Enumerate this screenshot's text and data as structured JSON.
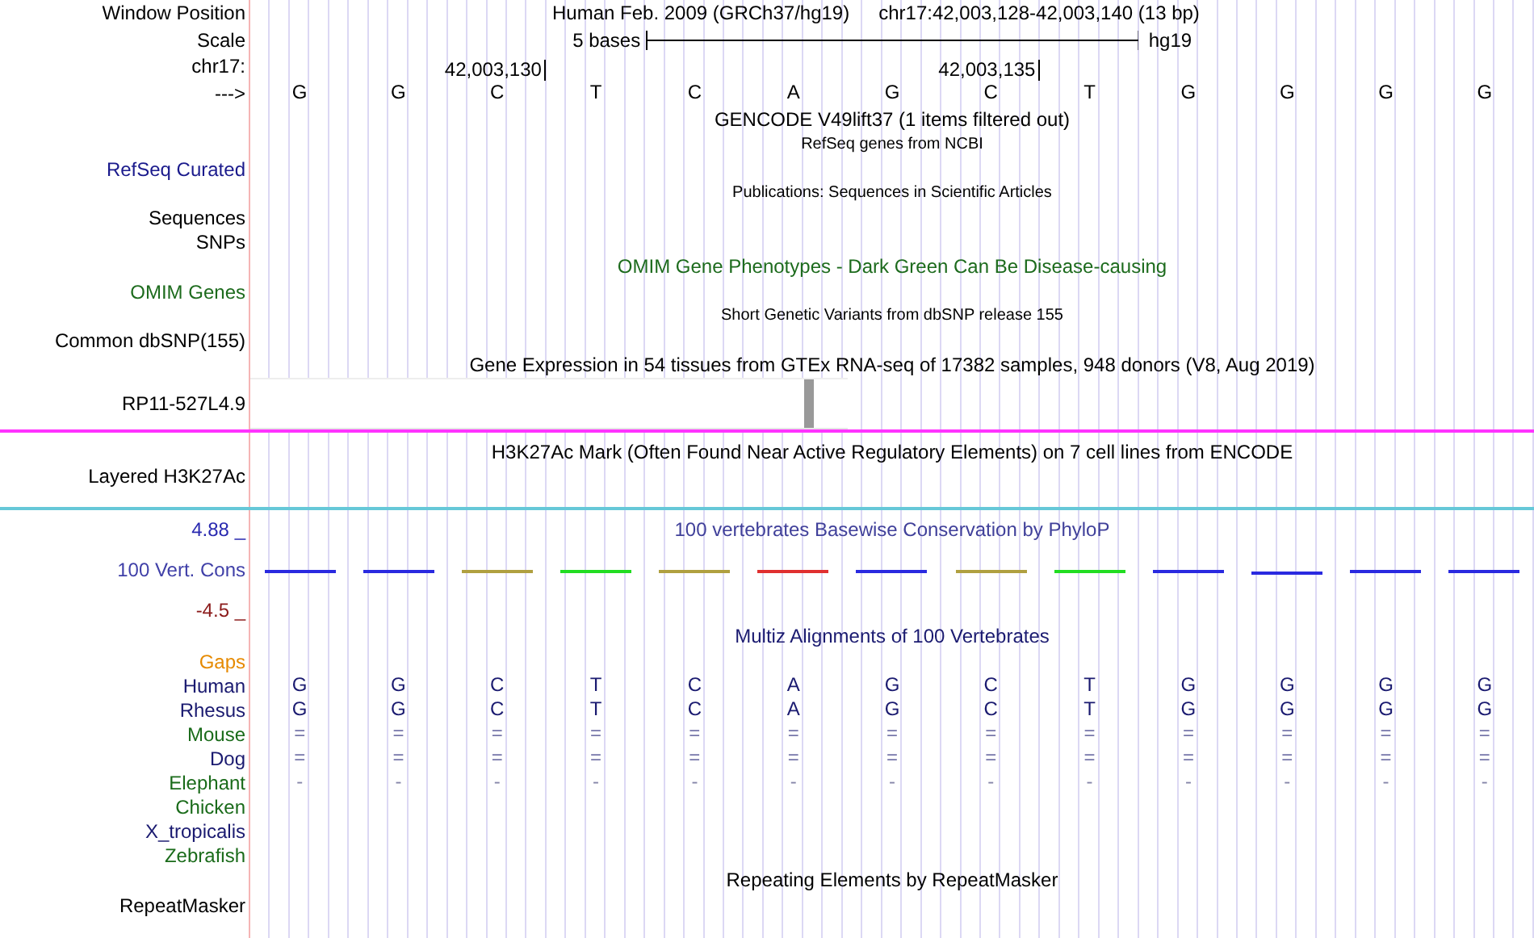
{
  "header": {
    "position_label": "Window Position",
    "assembly": "Human Feb. 2009 (GRCh37/hg19)",
    "range": "chr17:42,003,128-42,003,140 (13 bp)",
    "scale_label": "Scale",
    "scale_span": "5 bases",
    "scale_assembly": "hg19",
    "chrom_label": "chr17:",
    "ticks": [
      "42,003,130",
      "42,003,135"
    ],
    "strand_label": "--->",
    "bases": [
      "G",
      "G",
      "C",
      "T",
      "C",
      "A",
      "G",
      "C",
      "T",
      "G",
      "G",
      "G",
      "G"
    ]
  },
  "tracks": [
    {
      "kind": "title",
      "text": "GENCODE V49lift37 (1 items filtered out)",
      "color": "#000000"
    },
    {
      "kind": "note",
      "text": "RefSeq genes from NCBI"
    },
    {
      "kind": "label",
      "text": "RefSeq Curated",
      "color": "#1a1a8c"
    },
    {
      "kind": "note",
      "text": "Publications: Sequences in Scientific Articles"
    },
    {
      "kind": "label",
      "text": "Sequences",
      "color": "#000000"
    },
    {
      "kind": "label",
      "text": "SNPs",
      "color": "#000000"
    },
    {
      "kind": "title",
      "text": "OMIM Gene Phenotypes - Dark Green Can Be Disease-causing",
      "color": "#1d6b1d"
    },
    {
      "kind": "label",
      "text": "OMIM Genes",
      "color": "#1d6b1d"
    },
    {
      "kind": "note",
      "text": "Short Genetic Variants from dbSNP release 155"
    },
    {
      "kind": "label",
      "text": "Common dbSNP(155)",
      "color": "#000000"
    },
    {
      "kind": "title",
      "text": "Gene Expression in 54 tissues from GTEx RNA-seq of 17382 samples, 948 donors (V8, Aug 2019)",
      "color": "#000000"
    },
    {
      "kind": "expression",
      "text": "RP11-527L4.9"
    },
    {
      "kind": "divider",
      "color": "#ff33ff"
    },
    {
      "kind": "title",
      "text": "H3K27Ac Mark (Often Found Near Active Regulatory Elements) on 7 cell lines from ENCODE",
      "color": "#000000"
    },
    {
      "kind": "signal",
      "text": "Layered H3K27Ac",
      "color": "#000000"
    },
    {
      "kind": "divider",
      "color": "#66c8d8"
    },
    {
      "kind": "conservation",
      "title": "100 vertebrates Basewise Conservation by PhyloP",
      "label": "100 Vert. Cons",
      "max": "4.88 _",
      "min": "-4.5 _",
      "segments": [
        {
          "color": "#2a2ae0"
        },
        {
          "color": "#2a2ae0"
        },
        {
          "color": "#b0a040"
        },
        {
          "color": "#22dd22"
        },
        {
          "color": "#b0a040"
        },
        {
          "color": "#e03030"
        },
        {
          "color": "#2a2ae0"
        },
        {
          "color": "#b0a040"
        },
        {
          "color": "#22dd22"
        },
        {
          "color": "#2a2ae0"
        },
        {
          "color": "#2a2ae0"
        },
        {
          "color": "#2a2ae0"
        },
        {
          "color": "#2a2ae0"
        }
      ]
    },
    {
      "kind": "title",
      "text": "Multiz Alignments of 100 Vertebrates",
      "color": "#1a1a70"
    },
    {
      "kind": "species",
      "text": "Gaps",
      "color": "#e68a00"
    },
    {
      "kind": "species",
      "text": "Human",
      "color": "#1a1a70",
      "alignment": {
        "color": "#1a1a70",
        "bases": [
          "G",
          "G",
          "C",
          "T",
          "C",
          "A",
          "G",
          "C",
          "T",
          "G",
          "G",
          "G",
          "G"
        ]
      }
    },
    {
      "kind": "species",
      "text": "Rhesus",
      "color": "#1a1a70",
      "alignment": {
        "color": "#1a1a70",
        "bases": [
          "G",
          "G",
          "C",
          "T",
          "C",
          "A",
          "G",
          "C",
          "T",
          "G",
          "G",
          "G",
          "G"
        ]
      }
    },
    {
      "kind": "species",
      "text": "Mouse",
      "color": "#1a6b1a",
      "alignment": {
        "color": "#7777aa",
        "bases": [
          "=",
          "=",
          "=",
          "=",
          "=",
          "=",
          "=",
          "=",
          "=",
          "=",
          "=",
          "=",
          "="
        ]
      }
    },
    {
      "kind": "species",
      "text": "Dog",
      "color": "#1a1a70",
      "alignment": {
        "color": "#7777aa",
        "bases": [
          "=",
          "=",
          "=",
          "=",
          "=",
          "=",
          "=",
          "=",
          "=",
          "=",
          "=",
          "=",
          "="
        ]
      }
    },
    {
      "kind": "species",
      "text": "Elephant",
      "color": "#1a6b1a",
      "alignment": {
        "color": "#8888aa",
        "bases": [
          "-",
          "-",
          "-",
          "-",
          "-",
          "-",
          "-",
          "-",
          "-",
          "-",
          "-",
          "-",
          "-"
        ]
      }
    },
    {
      "kind": "species",
      "text": "Chicken",
      "color": "#1a6b1a"
    },
    {
      "kind": "species",
      "text": "X_tropicalis",
      "color": "#1a1a70"
    },
    {
      "kind": "species",
      "text": "Zebrafish",
      "color": "#1a6b1a"
    },
    {
      "kind": "title",
      "text": "Repeating Elements by RepeatMasker",
      "color": "#000000"
    },
    {
      "kind": "label",
      "text": "RepeatMasker",
      "color": "#000000"
    }
  ]
}
